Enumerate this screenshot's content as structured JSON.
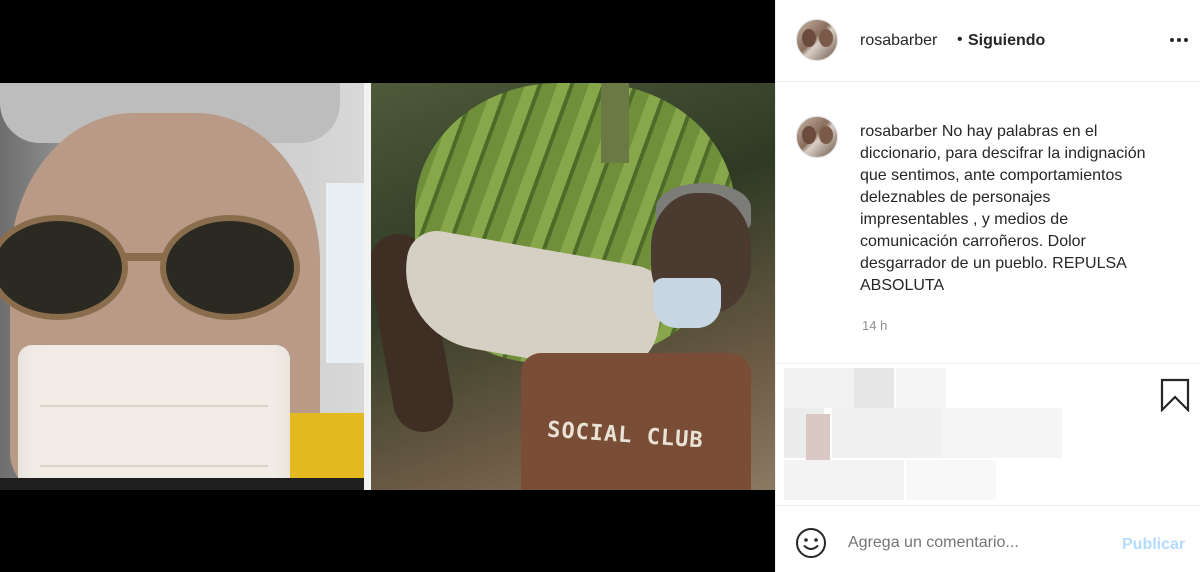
{
  "post": {
    "username": "rosabarber",
    "separator": "•",
    "follow_status": "Siguiendo",
    "more_icon": "more-horizontal-icon",
    "caption_user": "rosabarber",
    "caption_text": "No hay palabras en el diccionario, para descifrar la indignación que sentimos, ante comportamientos deleznables de personajes impresentables , y medios de comunicación carroñeros. Dolor desgarrador de un pueblo. REPULSA ABSOLUTA",
    "timestamp": "14 h"
  },
  "media": {
    "shirt_text": "SOCIAL CLUB"
  },
  "comment": {
    "placeholder": "Agrega un comentario...",
    "publish_label": "Publicar"
  },
  "colors": {
    "publish_disabled": "#b3dbff",
    "muted_text": "#8e8e8e",
    "border": "#efefef"
  }
}
